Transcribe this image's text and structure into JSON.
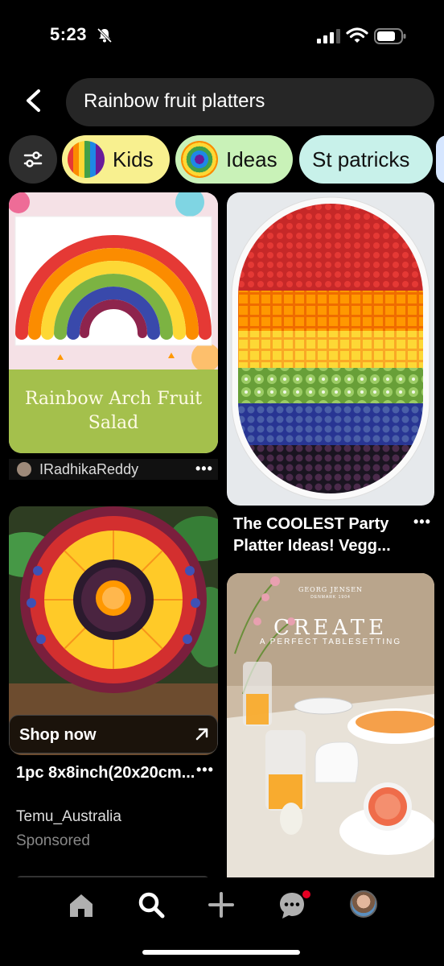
{
  "status": {
    "time": "5:23"
  },
  "search": {
    "query": "Rainbow fruit platters"
  },
  "chips": [
    {
      "label": "Kids",
      "bg": "#f8f08f"
    },
    {
      "label": "Ideas",
      "bg": "#c9f2b8"
    },
    {
      "label": "St patricks",
      "bg": "#c8f1ea"
    }
  ],
  "pins": {
    "pin1": {
      "overlay": "Rainbow Arch Fruit Salad",
      "author": "IRadhikaReddy",
      "more": "•••"
    },
    "pin2": {
      "title": "The COOLEST Party Platter Ideas! Vegg...",
      "more": "•••"
    },
    "pin3": {
      "shop_label": "Shop now",
      "title": "1pc 8x8inch(20x20cm...",
      "seller": "Temu_Australia",
      "sponsored": "Sponsored",
      "more": "•••"
    },
    "pin4": {
      "brand": "GEORG JENSEN",
      "brand_sub": "DENMARK 1904",
      "headline": "CREATE",
      "subheadline": "A PERFECT TABLESETTING"
    }
  },
  "nav": {
    "items": [
      {
        "icon": "home-icon"
      },
      {
        "icon": "search-icon"
      },
      {
        "icon": "plus-icon"
      },
      {
        "icon": "messages-icon"
      },
      {
        "icon": "profile-avatar"
      }
    ],
    "notification_color": "#e60023"
  }
}
